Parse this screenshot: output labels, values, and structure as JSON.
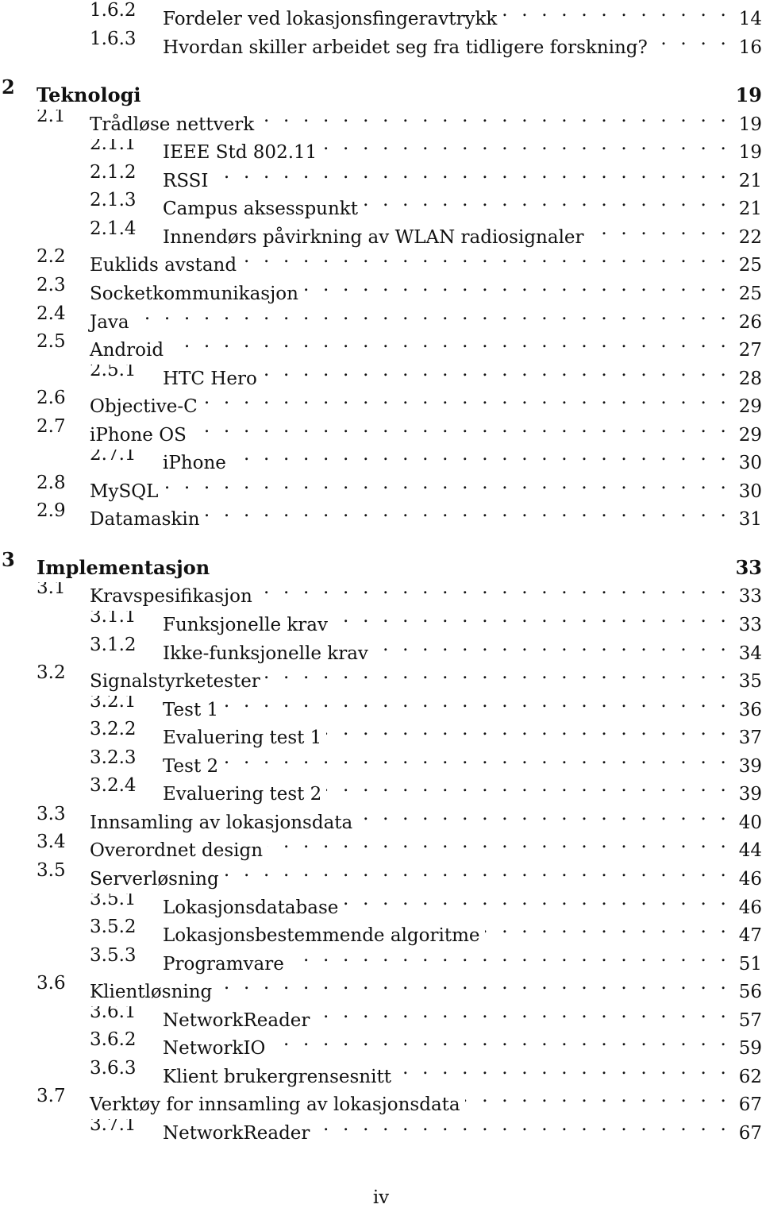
{
  "document": {
    "type": "table-of-contents",
    "page_label": "iv"
  },
  "toc": [
    {
      "level": "subsection",
      "number": "1.6.2",
      "title": "Fordeler ved lokasjonsfingeravtrykk",
      "page": "14"
    },
    {
      "level": "subsection",
      "number": "1.6.3",
      "title": "Hvordan skiller arbeidet seg fra tidligere forskning?",
      "page": "16"
    },
    {
      "level": "chapter",
      "number": "2",
      "title": "Teknologi",
      "page": "19"
    },
    {
      "level": "section",
      "number": "2.1",
      "title": "Trådløse nettverk",
      "page": "19"
    },
    {
      "level": "subsection",
      "number": "2.1.1",
      "title": "IEEE Std 802.11",
      "page": "19"
    },
    {
      "level": "subsection",
      "number": "2.1.2",
      "title": "RSSI",
      "page": "21"
    },
    {
      "level": "subsection",
      "number": "2.1.3",
      "title": "Campus aksesspunkt",
      "page": "21"
    },
    {
      "level": "subsection",
      "number": "2.1.4",
      "title": "Innendørs påvirkning av WLAN radiosignaler",
      "page": "22"
    },
    {
      "level": "section",
      "number": "2.2",
      "title": "Euklids avstand",
      "page": "25"
    },
    {
      "level": "section",
      "number": "2.3",
      "title": "Socketkommunikasjon",
      "page": "25"
    },
    {
      "level": "section",
      "number": "2.4",
      "title": "Java",
      "page": "26"
    },
    {
      "level": "section",
      "number": "2.5",
      "title": "Android",
      "page": "27"
    },
    {
      "level": "subsection",
      "number": "2.5.1",
      "title": "HTC Hero",
      "page": "28"
    },
    {
      "level": "section",
      "number": "2.6",
      "title": "Objective-C",
      "page": "29"
    },
    {
      "level": "section",
      "number": "2.7",
      "title": "iPhone OS",
      "page": "29"
    },
    {
      "level": "subsection",
      "number": "2.7.1",
      "title": "iPhone",
      "page": "30"
    },
    {
      "level": "section",
      "number": "2.8",
      "title": "MySQL",
      "page": "30"
    },
    {
      "level": "section",
      "number": "2.9",
      "title": "Datamaskin",
      "page": "31"
    },
    {
      "level": "chapter",
      "number": "3",
      "title": "Implementasjon",
      "page": "33"
    },
    {
      "level": "section",
      "number": "3.1",
      "title": "Kravspesifikasjon",
      "page": "33"
    },
    {
      "level": "subsection",
      "number": "3.1.1",
      "title": "Funksjonelle krav",
      "page": "33"
    },
    {
      "level": "subsection",
      "number": "3.1.2",
      "title": "Ikke-funksjonelle krav",
      "page": "34"
    },
    {
      "level": "section",
      "number": "3.2",
      "title": "Signalstyrketester",
      "page": "35"
    },
    {
      "level": "subsection",
      "number": "3.2.1",
      "title": "Test 1",
      "page": "36"
    },
    {
      "level": "subsection",
      "number": "3.2.2",
      "title": "Evaluering test 1",
      "page": "37"
    },
    {
      "level": "subsection",
      "number": "3.2.3",
      "title": "Test 2",
      "page": "39"
    },
    {
      "level": "subsection",
      "number": "3.2.4",
      "title": "Evaluering test 2",
      "page": "39"
    },
    {
      "level": "section",
      "number": "3.3",
      "title": "Innsamling av lokasjonsdata",
      "page": "40"
    },
    {
      "level": "section",
      "number": "3.4",
      "title": "Overordnet design",
      "page": "44"
    },
    {
      "level": "section",
      "number": "3.5",
      "title": "Serverløsning",
      "page": "46"
    },
    {
      "level": "subsection",
      "number": "3.5.1",
      "title": "Lokasjonsdatabase",
      "page": "46"
    },
    {
      "level": "subsection",
      "number": "3.5.2",
      "title": "Lokasjonsbestemmende algoritme",
      "page": "47"
    },
    {
      "level": "subsection",
      "number": "3.5.3",
      "title": "Programvare",
      "page": "51"
    },
    {
      "level": "section",
      "number": "3.6",
      "title": "Klientløsning",
      "page": "56"
    },
    {
      "level": "subsection",
      "number": "3.6.1",
      "title": "NetworkReader",
      "page": "57"
    },
    {
      "level": "subsection",
      "number": "3.6.2",
      "title": "NetworkIO",
      "page": "59"
    },
    {
      "level": "subsection",
      "number": "3.6.3",
      "title": "Klient brukergrensesnitt",
      "page": "62"
    },
    {
      "level": "section",
      "number": "3.7",
      "title": "Verktøy for innsamling av lokasjonsdata",
      "page": "67"
    },
    {
      "level": "subsection",
      "number": "3.7.1",
      "title": "NetworkReader",
      "page": "67"
    }
  ]
}
